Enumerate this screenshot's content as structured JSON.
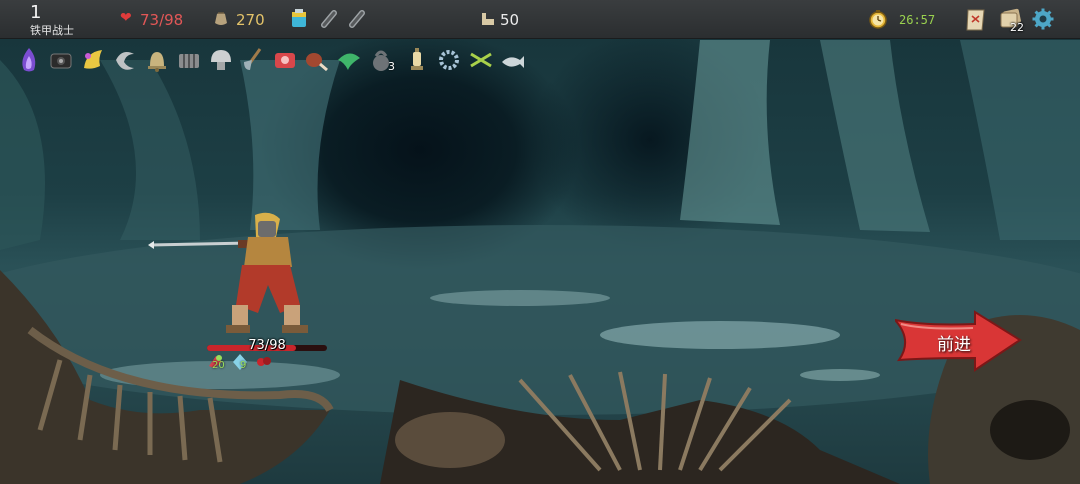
{
  "player": {
    "floor": "1",
    "character_name": "铁甲战士",
    "hp_display": "73/98",
    "hp_current": 73,
    "hp_max": 98,
    "gold": "270",
    "floor_count": "50",
    "timer": "26:57",
    "deck_count": "22",
    "strength": "20",
    "dexterity": "9"
  },
  "potions": [
    "blue-potion",
    "empty-potion-slot",
    "empty-potion-slot"
  ],
  "relics": [
    {
      "icon": "purple-flame-relic-icon"
    },
    {
      "icon": "camera-relic-icon"
    },
    {
      "icon": "golden-wing-relic-icon"
    },
    {
      "icon": "crescent-horn-relic-icon"
    },
    {
      "icon": "bell-relic-icon"
    },
    {
      "icon": "cage-relic-icon"
    },
    {
      "icon": "mushroom-cap-relic-icon"
    },
    {
      "icon": "shovel-relic-icon"
    },
    {
      "icon": "red-box-relic-icon"
    },
    {
      "icon": "meat-on-bone-relic-icon"
    },
    {
      "icon": "green-leaf-relic-icon"
    },
    {
      "icon": "kettlebell-relic-icon",
      "count": "3"
    },
    {
      "icon": "lantern-relic-icon"
    },
    {
      "icon": "bead-ring-relic-icon"
    },
    {
      "icon": "green-arrows-relic-icon"
    },
    {
      "icon": "whale-relic-icon"
    }
  ],
  "proceed_label": "前进",
  "colors": {
    "hp": "#e25757",
    "gold": "#e3c36a",
    "timer": "#9ad14f",
    "proceed_arrow": "#d93636"
  }
}
